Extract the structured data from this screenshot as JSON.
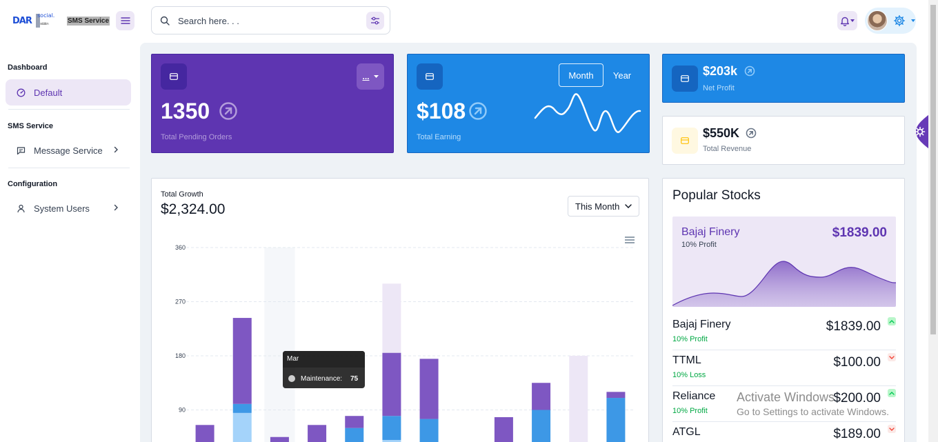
{
  "brand": {
    "logo_text": "DAR",
    "logo_small": "social.",
    "logo_tiny": "solution",
    "service_label": "SMS Service"
  },
  "search": {
    "placeholder": "Search here. . ."
  },
  "sidebar": {
    "sections": [
      {
        "title": "Dashboard",
        "items": [
          {
            "label": "Default",
            "active": true
          }
        ]
      },
      {
        "title": "SMS Service",
        "items": [
          {
            "label": "Message Service"
          }
        ]
      },
      {
        "title": "Configuration",
        "items": [
          {
            "label": "System Users"
          }
        ]
      }
    ]
  },
  "cards": {
    "orders": {
      "value": "1350",
      "label": "Total Pending Orders",
      "more": "..."
    },
    "earning": {
      "value": "$108",
      "label": "Total Earning",
      "toggle_month": "Month",
      "toggle_year": "Year"
    },
    "profit": {
      "value": "$203k",
      "label": "Net Profit"
    },
    "revenue": {
      "value": "$550K",
      "label": "Total Revenue"
    }
  },
  "growth": {
    "title": "Total Growth",
    "amount": "$2,324.00",
    "period": "This Month",
    "tooltip": {
      "title": "Mar",
      "series": "Maintenance:",
      "value": "75"
    }
  },
  "chart_data": {
    "type": "bar",
    "stacked": true,
    "ylim": [
      0,
      360
    ],
    "ticks": [
      90,
      180,
      270,
      360
    ],
    "series_colors": [
      "#a4d3fa",
      "#3d98e6",
      "#7e57c2",
      "#ede7f6"
    ],
    "bars": [
      [
        0,
        30,
        35,
        0
      ],
      [
        85,
        15,
        143,
        0
      ],
      [
        0,
        10,
        35,
        0
      ],
      [
        0,
        30,
        35,
        0
      ],
      [
        0,
        60,
        20,
        0
      ],
      [
        40,
        40,
        105,
        115
      ],
      [
        0,
        75,
        100,
        0
      ],
      [
        0,
        5,
        8,
        0
      ],
      [
        0,
        10,
        68,
        0
      ],
      [
        5,
        85,
        45,
        0
      ],
      [
        0,
        0,
        30,
        150
      ],
      [
        35,
        75,
        10,
        0
      ]
    ],
    "grid": true
  },
  "stocks": {
    "title": "Popular Stocks",
    "featured": {
      "name": "Bajaj Finery",
      "profit": "10% Profit",
      "value": "$1839.00"
    },
    "rows": [
      {
        "name": "Bajaj Finery",
        "change": "10% Profit",
        "value": "$1839.00",
        "trend": "up"
      },
      {
        "name": "TTML",
        "change": "10% Loss",
        "value": "$100.00",
        "trend": "down"
      },
      {
        "name": "Reliance",
        "change": "10% Profit",
        "value": "$200.00",
        "trend": "up"
      },
      {
        "name": "ATGL",
        "change": "10% Loss",
        "value": "$189.00",
        "trend": "down"
      }
    ]
  },
  "watermark": {
    "line1": "Activate Windows",
    "line2": "Go to Settings to activate Windows."
  },
  "colors": {
    "primary": "#5e35b1",
    "secondary": "#1e88e5",
    "success": "#00c853",
    "error": "#f44336"
  }
}
